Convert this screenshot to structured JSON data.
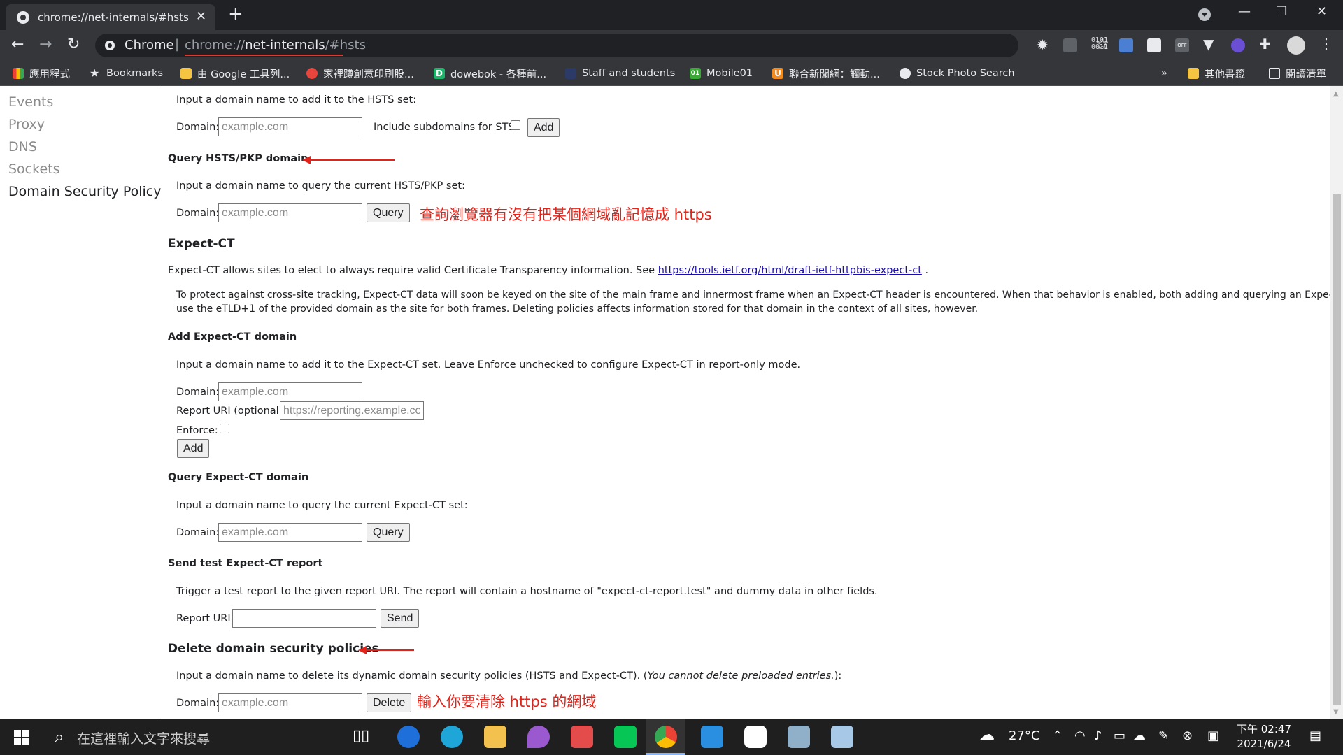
{
  "browser": {
    "tab_title": "chrome://net-internals/#hsts",
    "chip": "Chrome",
    "url_scheme": "chrome://",
    "url_host": "net-internals",
    "url_path": "/#hsts",
    "ext_binary": "0101\n0011",
    "ext_off": "OFF",
    "bookmarks": [
      {
        "label": "應用程式",
        "icon": "apps-grid-icon"
      },
      {
        "label": "Bookmarks",
        "icon": "star-icon"
      },
      {
        "label": "由 Google 工具列...",
        "icon": "folder-icon"
      },
      {
        "label": "家裡蹲創意印刷股...",
        "icon": "site-icon"
      },
      {
        "label": "dowebok - 各種前...",
        "icon": "site-icon",
        "letter": "D"
      },
      {
        "label": "Staff and students",
        "icon": "site-icon"
      },
      {
        "label": "Mobile01",
        "icon": "site-icon",
        "letter": "01"
      },
      {
        "label": "聯合新聞網：觸動...",
        "icon": "site-icon",
        "letter": "U"
      },
      {
        "label": "Stock Photo Search",
        "icon": "globe-icon"
      }
    ],
    "bookmarks_overflow": "»",
    "other_bookmarks": "其他書籤",
    "reading_list": "閱讀清單"
  },
  "sidebar": {
    "items": [
      {
        "label": "Events"
      },
      {
        "label": "Proxy"
      },
      {
        "label": "DNS"
      },
      {
        "label": "Sockets"
      },
      {
        "label": "Domain Security Policy",
        "active": true
      }
    ]
  },
  "hsts_add": {
    "intro": "Input a domain name to add it to the HSTS set:",
    "domain_label": "Domain:",
    "placeholder": "example.com",
    "subdomains_label": "Include subdomains for STS:",
    "add_label": "Add"
  },
  "hsts_query": {
    "heading": "Query HSTS/PKP domain",
    "intro": "Input a domain name to query the current HSTS/PKP set:",
    "domain_label": "Domain:",
    "placeholder": "example.com",
    "query_label": "Query",
    "annotation": "查詢瀏覽器有沒有把某個網域亂記憶成 https"
  },
  "expect_ct": {
    "heading": "Expect-CT",
    "desc_prefix": "Expect-CT allows sites to elect to always require valid Certificate Transparency information. See ",
    "desc_link": "https://tools.ietf.org/html/draft-ietf-httpbis-expect-ct",
    "desc_suffix": " .",
    "note_line1": "To protect against cross-site tracking, Expect-CT data will soon be keyed on the site of the main frame and innermost frame when an Expect-CT header is encountered. When that behavior is enabled, both adding and querying an Expect-CT domain",
    "note_line2": "use the eTLD+1 of the provided domain as the site for both frames. Deleting policies affects information stored for that domain in the context of all sites, however."
  },
  "ct_add": {
    "heading": "Add Expect-CT domain",
    "intro": "Input a domain name to add it to the Expect-CT set. Leave Enforce unchecked to configure Expect-CT in report-only mode.",
    "domain_label": "Domain:",
    "domain_placeholder": "example.com",
    "report_label": "Report URI (optional):",
    "report_placeholder": "https://reporting.example.com",
    "enforce_label": "Enforce:",
    "add_label": "Add"
  },
  "ct_query": {
    "heading": "Query Expect-CT domain",
    "intro": "Input a domain name to query the current Expect-CT set:",
    "domain_label": "Domain:",
    "placeholder": "example.com",
    "query_label": "Query"
  },
  "ct_test": {
    "heading": "Send test Expect-CT report",
    "intro": "Trigger a test report to the given report URI. The report will contain a hostname of \"expect-ct-report.test\" and dummy data in other fields.",
    "uri_label": "Report URI:",
    "send_label": "Send"
  },
  "delete": {
    "heading": "Delete domain security policies",
    "intro_prefix": "Input a domain name to delete its dynamic domain security policies (HSTS and Expect-CT). (",
    "intro_em": "You cannot delete preloaded entries.",
    "intro_suffix": "):",
    "domain_label": "Domain:",
    "placeholder": "example.com",
    "delete_label": "Delete",
    "annotation": "輸入你要清除 https 的網域"
  },
  "taskbar": {
    "search_placeholder": "在這裡輸入文字來搜尋",
    "weather": "27°C",
    "time": "下午 02:47",
    "date": "2021/6/24"
  },
  "colors": {
    "annotation_red": "#e3231a",
    "chrome_dark": "#35363a",
    "link_blue": "#1a0dab"
  }
}
